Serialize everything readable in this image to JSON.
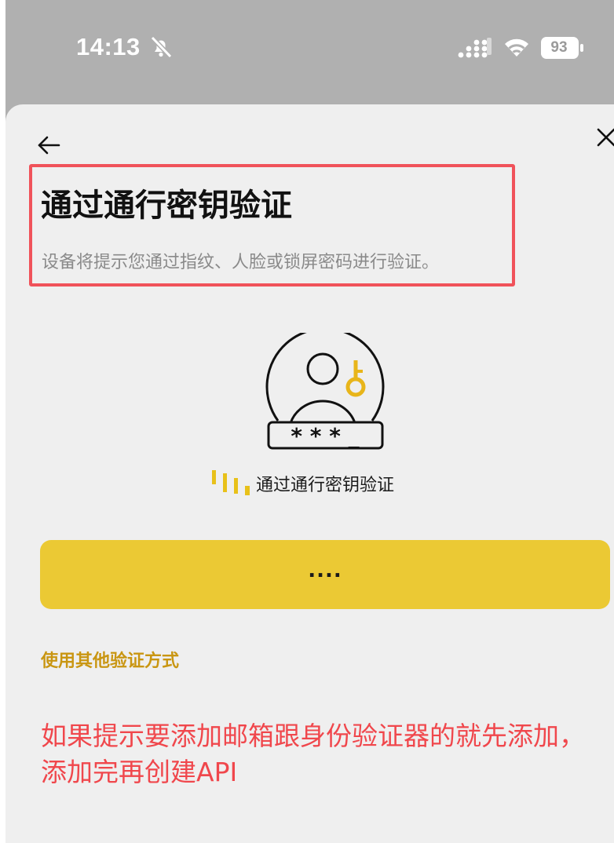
{
  "status_bar": {
    "time": "14:13",
    "battery": "93"
  },
  "page": {
    "title": "通过通行密钥验证",
    "subtitle": "设备将提示您通过指纹、人脸或锁屏密码进行验证。"
  },
  "illustration": {
    "password_mask": "* * * _"
  },
  "status": {
    "text": "通过通行密钥验证"
  },
  "primary_button": {
    "label": "...."
  },
  "other_method_link": "使用其他验证方式",
  "annotation": "如果提示要添加邮箱跟身份验证器的就先添加，添加完再创建API",
  "colors": {
    "accent_yellow": "#ebc934",
    "link_gold": "#c99612",
    "key_gold": "#e8b51a",
    "highlight_red": "#f0525a",
    "annotation_red": "#f0474c",
    "sheet_background": "#efefef"
  }
}
